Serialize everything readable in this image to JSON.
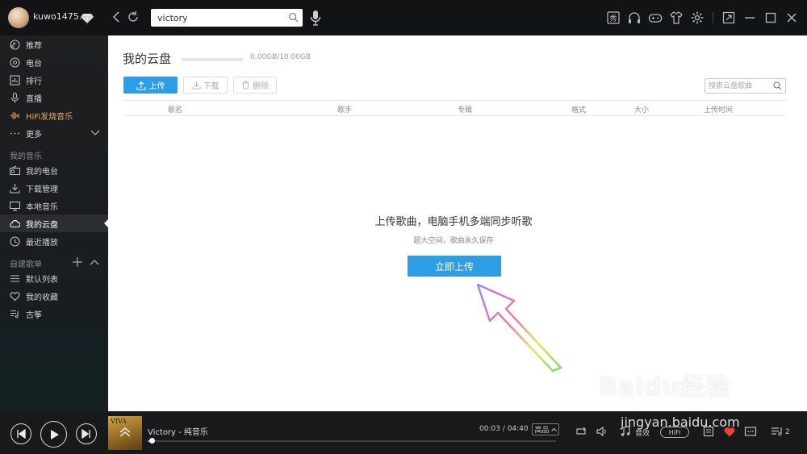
{
  "topbar": {
    "username": "kuwo1475...",
    "search_value": "victory",
    "icons": [
      "back-icon",
      "refresh-icon",
      "search-icon",
      "mic-icon",
      "show-icon",
      "headphones-icon",
      "gamepad-icon",
      "skin-shirt-icon",
      "settings-gear-icon",
      "mini-mode-icon",
      "minimize-icon",
      "maximize-icon",
      "close-icon"
    ]
  },
  "sidebar": {
    "discover": [
      {
        "label": "推荐",
        "icon": "recommend-icon"
      },
      {
        "label": "电台",
        "icon": "radio-icon"
      },
      {
        "label": "排行",
        "icon": "chart-icon"
      },
      {
        "label": "直播",
        "icon": "mic-live-icon"
      },
      {
        "label": "HiFi发烧音乐",
        "icon": "hifi-wave-icon"
      },
      {
        "label": "更多",
        "icon": "more-dots-icon"
      }
    ],
    "my_music_title": "我的音乐",
    "my_music": [
      {
        "label": "我的电台",
        "icon": "my-radio-icon"
      },
      {
        "label": "下载管理",
        "icon": "download-icon"
      },
      {
        "label": "本地音乐",
        "icon": "monitor-icon"
      },
      {
        "label": "我的云盘",
        "icon": "cloud-icon",
        "active": true
      },
      {
        "label": "最近播放",
        "icon": "clock-icon"
      }
    ],
    "playlist_title": "自建歌单",
    "playlists": [
      {
        "label": "默认列表",
        "icon": "list-icon"
      },
      {
        "label": "我的收藏",
        "icon": "heart-outline-icon"
      },
      {
        "label": "古筝",
        "icon": "playlist-icon"
      }
    ]
  },
  "main": {
    "title": "我的云盘",
    "storage_text": "0.00GB/10.00GB",
    "storage_used_fraction": 0.0,
    "buttons": {
      "upload": "上传",
      "download": "下载",
      "delete": "删除"
    },
    "search_placeholder": "搜索云盘歌曲",
    "columns": [
      "歌名",
      "歌手",
      "专辑",
      "格式",
      "大小",
      "上传时间"
    ],
    "empty": {
      "title": "上传歌曲，电脑手机多端同步听歌",
      "subtitle": "超大空间，歌曲永久保存",
      "cta": "立即上传"
    }
  },
  "player": {
    "cover_label": "VIVA",
    "track": "Victory - 纯音乐",
    "time": "00:03 / 04:40",
    "progress_fraction": 0.011,
    "quality": "高品",
    "sound_effect": "音效",
    "hifi": "HiFi",
    "queue_count": "2"
  },
  "watermark": {
    "logo": "Baidu经验",
    "url": "jingyan.baidu.com"
  },
  "colors": {
    "accent": "#2d9ee6",
    "hifi": "#e7a86a",
    "heart": "#e8403a"
  }
}
